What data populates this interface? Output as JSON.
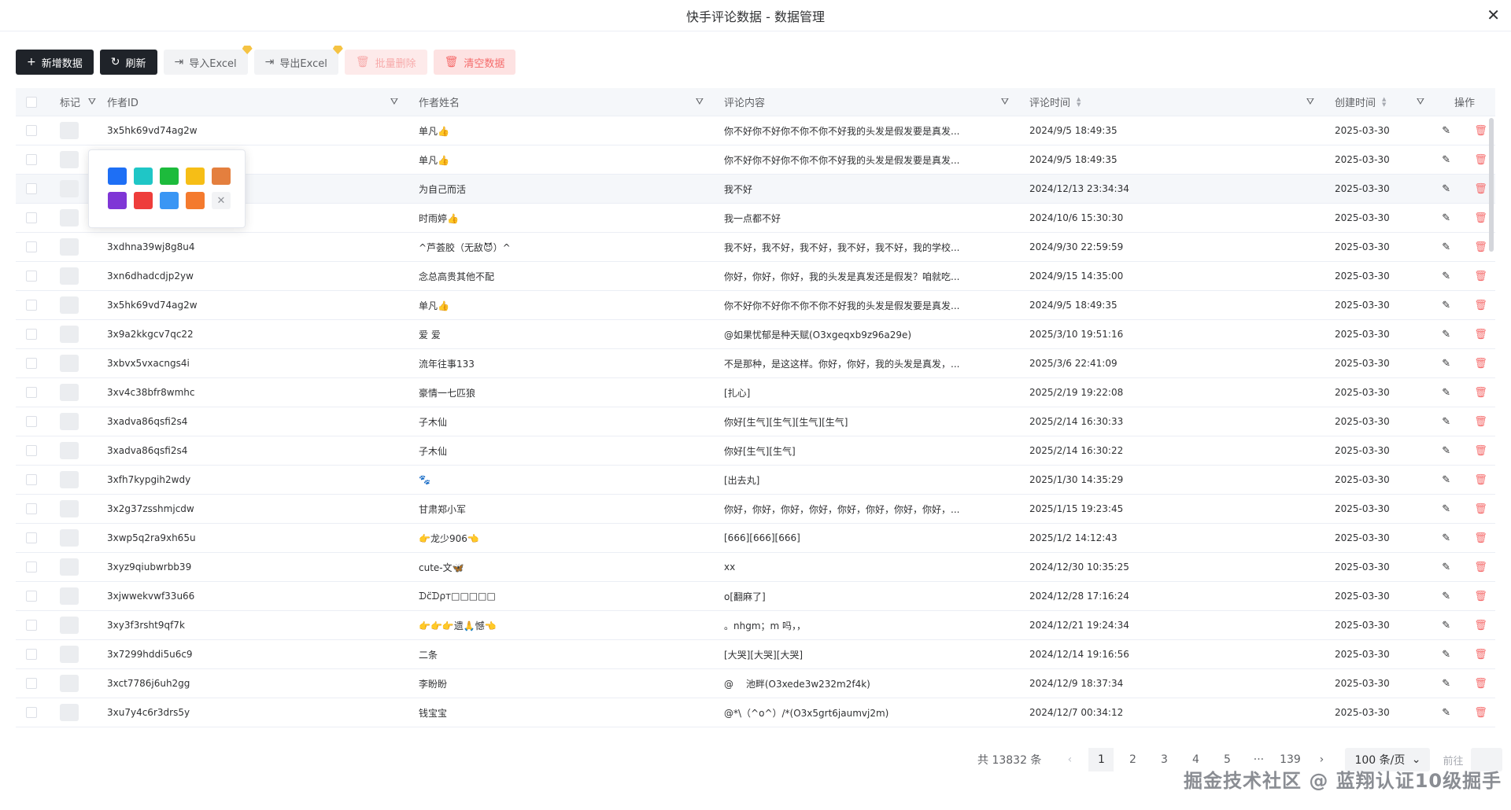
{
  "window": {
    "title": "快手评论数据 - 数据管理",
    "close": "✕"
  },
  "toolbar": {
    "add": {
      "icon": "+",
      "label": "新增数据"
    },
    "refresh": {
      "icon": "↻",
      "label": "刷新"
    },
    "import": {
      "icon": "⇥",
      "label": "导入Excel"
    },
    "export": {
      "icon": "⇥",
      "label": "导出Excel"
    },
    "batch_delete": {
      "icon": "🗑",
      "label": "批量删除"
    },
    "clear": {
      "icon": "🗑",
      "label": "清空数据"
    }
  },
  "columns": {
    "tag": "标记",
    "author_id": "作者ID",
    "author_name": "作者姓名",
    "content": "评论内容",
    "comment_time": "评论时间",
    "created": "创建时间",
    "ops": "操作"
  },
  "icons": {
    "filter": "⛛",
    "edit": "✎",
    "delete": "🗑"
  },
  "color_swatches": [
    "#1e6ff5",
    "#1fc6c6",
    "#1dbb3c",
    "#f6be16",
    "#e47f3e",
    "#7f36d6",
    "#ee3d3b",
    "#3a96f4",
    "#f47a2e"
  ],
  "rows": [
    {
      "id": "3x5hk69vd74ag2w",
      "name": "单凡👍",
      "content": "你不好你不好你不你不你不好我的头发是假发要是真发...",
      "time": "2024/9/5 18:49:35",
      "created": "2025-03-30"
    },
    {
      "id": "",
      "name": "单凡👍",
      "content": "你不好你不好你不你不你不好我的头发是假发要是真发...",
      "time": "2024/9/5 18:49:35",
      "created": "2025-03-30"
    },
    {
      "id": "",
      "name": "为自己而活",
      "content": "我不好",
      "time": "2024/12/13 23:34:34",
      "created": "2025-03-30"
    },
    {
      "id": "",
      "name": "时雨婷👍",
      "content": "我一点都不好",
      "time": "2024/10/6 15:30:30",
      "created": "2025-03-30"
    },
    {
      "id": "3xdhna39wj8g8u4",
      "name": "^芦荟胶（无敌😈）^",
      "content": "我不好，我不好，我不好，我不好，我不好，我的学校...",
      "time": "2024/9/30 22:59:59",
      "created": "2025-03-30"
    },
    {
      "id": "3xn6dhadcdjp2yw",
      "name": "念总高贵其他不配",
      "content": "你好，你好，你好，我的头发是真发还是假发？咱就吃...",
      "time": "2024/9/15 14:35:00",
      "created": "2025-03-30"
    },
    {
      "id": "3x5hk69vd74ag2w",
      "name": "单凡👍",
      "content": "你不好你不好你不你不你不好我的头发是假发要是真发...",
      "time": "2024/9/5 18:49:35",
      "created": "2025-03-30"
    },
    {
      "id": "3x9a2kkgcv7qc22",
      "name": "爱 爱",
      "content": "@如果忧郁是种天赋(O3xgeqxb9z96a29e)",
      "time": "2025/3/10 19:51:16",
      "created": "2025-03-30"
    },
    {
      "id": "3xbvx5vxacngs4i",
      "name": "流年往事133",
      "content": "不是那种，是这这样。你好，你好，我的头发是真发，...",
      "time": "2025/3/6 22:41:09",
      "created": "2025-03-30"
    },
    {
      "id": "3xv4c38bfr8wmhc",
      "name": "豪情一七匹狼",
      "content": "[扎心]",
      "time": "2025/2/19 19:22:08",
      "created": "2025-03-30"
    },
    {
      "id": "3xadva86qsfi2s4",
      "name": "子木仙",
      "content": "你好[生气][生气][生气][生气]",
      "time": "2025/2/14 16:30:33",
      "created": "2025-03-30"
    },
    {
      "id": "3xadva86qsfi2s4",
      "name": "子木仙",
      "content": "你好[生气][生气]",
      "time": "2025/2/14 16:30:22",
      "created": "2025-03-30"
    },
    {
      "id": "3xfh7kypgih2wdy",
      "name": "🐾",
      "content": "[出去丸]",
      "time": "2025/1/30 14:35:29",
      "created": "2025-03-30"
    },
    {
      "id": "3x2g37zsshmjcdw",
      "name": "甘肃郑小军",
      "content": "你好，你好，你好，你好，你好，你好，你好，你好，...",
      "time": "2025/1/15 19:23:45",
      "created": "2025-03-30"
    },
    {
      "id": "3xwp5q2ra9xh65u",
      "name": "👉龙少906👈",
      "content": "[666][666][666]",
      "time": "2025/1/2 14:12:43",
      "created": "2025-03-30"
    },
    {
      "id": "3xyz9qiubwrbb39",
      "name": "cute-文🦋",
      "content": "xx",
      "time": "2024/12/30 10:35:25",
      "created": "2025-03-30"
    },
    {
      "id": "3xjwwekvwf33u66",
      "name": "ᗪc̈ᗪρт□□□□□",
      "content": "o[翻麻了]",
      "time": "2024/12/28 17:16:24",
      "created": "2025-03-30"
    },
    {
      "id": "3xy3f3rsht9qf7k",
      "name": "👉👉👉遗🙏憾👈",
      "content": "。nhgm；m 吗，，",
      "time": "2024/12/21 19:24:34",
      "created": "2025-03-30"
    },
    {
      "id": "3x7299hddi5u6c9",
      "name": "二条",
      "content": "[大哭][大哭][大哭]",
      "time": "2024/12/14 19:16:56",
      "created": "2025-03-30"
    },
    {
      "id": "3xct7786j6uh2gg",
      "name": "李盼盼",
      "content": "@ 　池畔(O3xede3w232m2f4k)",
      "time": "2024/12/9 18:37:34",
      "created": "2025-03-30"
    },
    {
      "id": "3xu7y4c6r3drs5y",
      "name": "钱宝宝",
      "content": "@*\\（^o^）/*(O3x5grt6jaumvj2m)",
      "time": "2024/12/7 00:34:12",
      "created": "2025-03-30"
    }
  ],
  "pager": {
    "total": "共 13832 条",
    "prev": "‹",
    "pages": [
      "1",
      "2",
      "3",
      "4",
      "5",
      "···",
      "139"
    ],
    "next": "›",
    "size": "100 条/页",
    "size_arrow": "⌄",
    "jump": "前往"
  },
  "watermark": "掘金技术社区 @ 蓝翔认证10级掘手"
}
